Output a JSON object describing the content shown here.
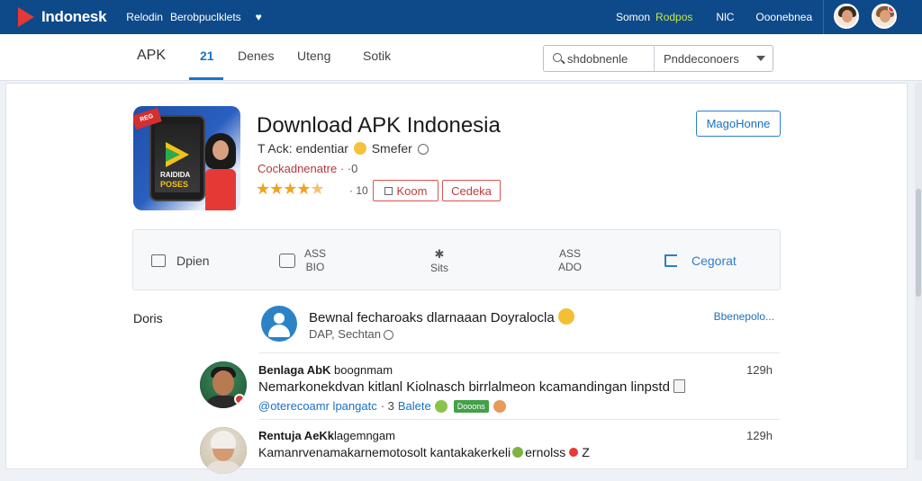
{
  "topbar": {
    "brand": "Indonesk",
    "nav_1": "Relodin",
    "nav_2": "Berobpuclklets",
    "right_1": "Somon",
    "right_2": "Rodpos",
    "right_3": "NlC",
    "right_4": "Ooonebnea",
    "accent_color": "#c6e54c",
    "bar_color": "#0e4a8a"
  },
  "tabs": {
    "apk": "APK",
    "active": "21",
    "tab_3": "Denes",
    "tab_4": "Uteng",
    "tab_5": "Sotik"
  },
  "search": {
    "query": "shdobnenle",
    "dropdown": "Pnddeconoers"
  },
  "app": {
    "title": "Download APK Indonesia",
    "developer": "T Ack: endentiar",
    "developer_suffix": "Smefer",
    "category": "Cockadnenatre ·",
    "category_count": "·0",
    "stars": "★★★★",
    "half_star": "★",
    "rating_count": "· 10",
    "btn_koom": "Koom",
    "btn_cedeka": "Cedeka",
    "btn_main": "MagoHonne",
    "icon_ribbon": "REG",
    "icon_text_1": "RAIDIDA",
    "icon_text_2": "POSES"
  },
  "stats": {
    "s1": "Dpien",
    "s2_top": "ASS",
    "s2_bottom": "BIO",
    "s3_bottom": "Sits",
    "s4_top": "ASS",
    "s4_bottom": "ADO",
    "s5": "Cegorat"
  },
  "feed": {
    "section_label": "Doris",
    "post": {
      "title": "Bewnal fecharoaks dlarnaaan Doyralocla",
      "sub": "DAP, Sechtan",
      "link": "Bbenepolo..."
    },
    "comments": [
      {
        "name": "Benlaga AbK",
        "handle": "boognmam",
        "text": "Nemarkonekdvan kitlanl Kiolnasch birrlalmeon kcamandingan linpstd",
        "meta_link": "@oterecoamr lpangatc",
        "meta_num": "· 3",
        "meta_tag_text": "Balete",
        "meta_tag": "Dooons",
        "time": "129h"
      },
      {
        "name": "Rentuja AeKk",
        "handle": "lagemngam",
        "text": "Kamanrvenamakarnemotosolt kantakakerkeli",
        "text_tail": "ernolss",
        "text_end": "Z",
        "time": "129h"
      }
    ]
  }
}
